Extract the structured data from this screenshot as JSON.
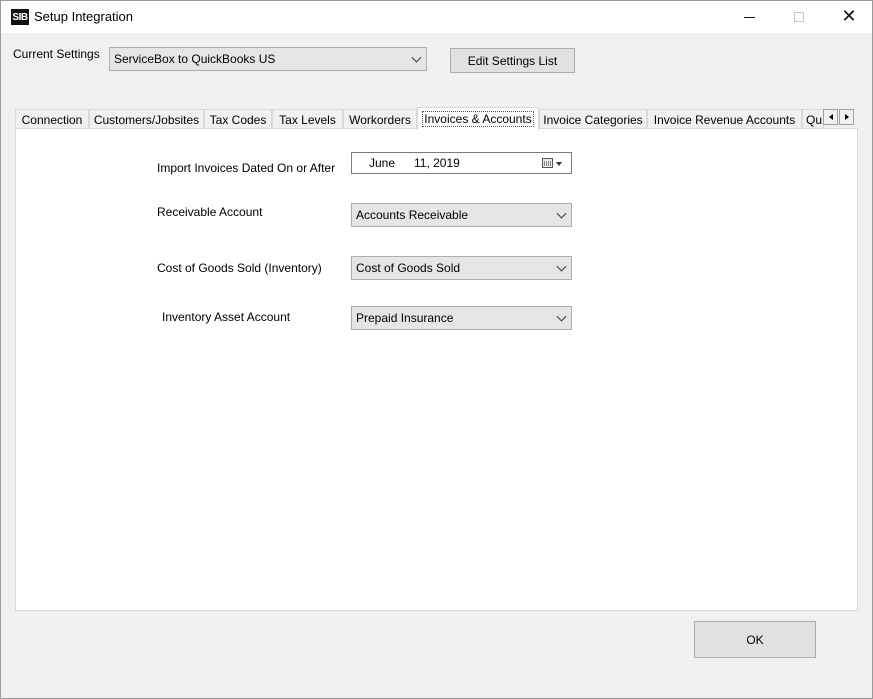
{
  "window": {
    "title": "Setup Integration",
    "icon_text": "SIB",
    "controls": {
      "minimize_icon": "minimize-icon",
      "maximize_icon": "maximize-icon",
      "close_icon": "close-icon",
      "close_glyph": "✕"
    }
  },
  "current_settings": {
    "label": "Current Settings",
    "value": "ServiceBox to QuickBooks US",
    "edit_button": "Edit Settings List"
  },
  "tabs": [
    {
      "label": "Connection",
      "active": false
    },
    {
      "label": "Customers/Jobsites",
      "active": false
    },
    {
      "label": "Tax Codes",
      "active": false
    },
    {
      "label": "Tax Levels",
      "active": false
    },
    {
      "label": "Workorders",
      "active": false
    },
    {
      "label": "Invoices & Accounts",
      "active": true
    },
    {
      "label": "Invoice Categories",
      "active": false
    },
    {
      "label": "Invoice Revenue Accounts",
      "active": false
    },
    {
      "label": "Qu",
      "active": false
    }
  ],
  "form": {
    "import_date": {
      "label": "Import Invoices Dated On or After",
      "month": "June",
      "day_year": "11, 2019"
    },
    "receivable": {
      "label": "Receivable Account",
      "value": "Accounts Receivable"
    },
    "cogs": {
      "label": "Cost of Goods Sold (Inventory)",
      "value": "Cost of Goods Sold"
    },
    "inventory_asset": {
      "label": "Inventory Asset Account",
      "value": "Prepaid Insurance"
    }
  },
  "footer": {
    "ok_button": "OK"
  }
}
